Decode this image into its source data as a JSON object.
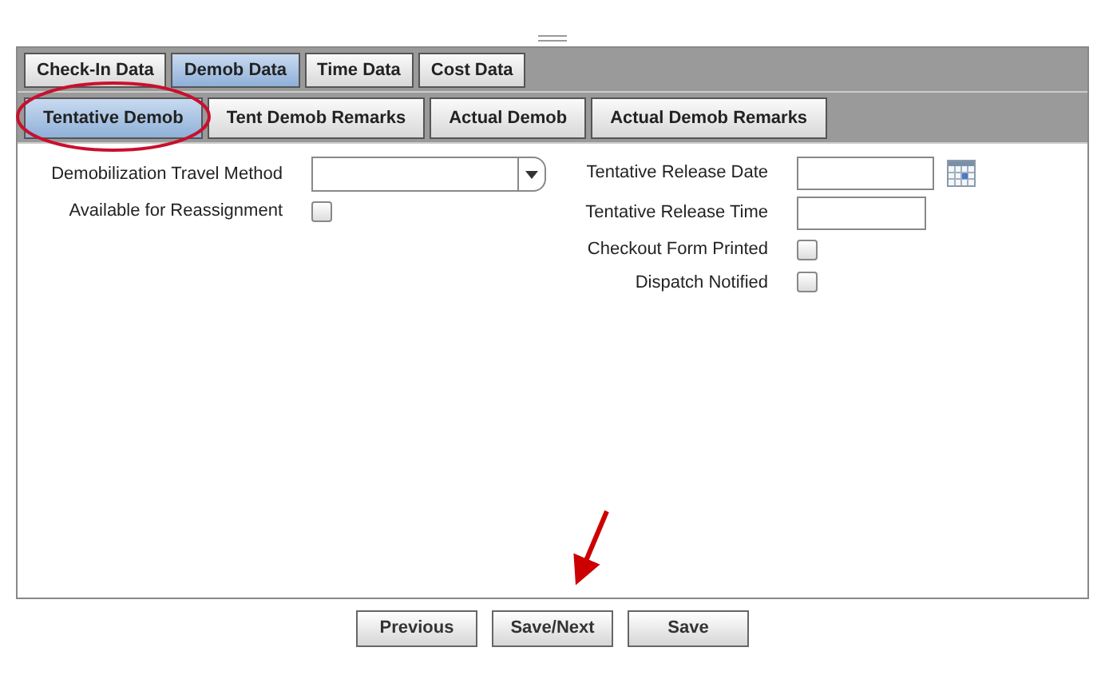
{
  "primary_tabs": [
    {
      "label": "Check-In Data",
      "selected": false
    },
    {
      "label": "Demob Data",
      "selected": true
    },
    {
      "label": "Time Data",
      "selected": false
    },
    {
      "label": "Cost Data",
      "selected": false
    }
  ],
  "secondary_tabs": [
    {
      "label": "Tentative Demob",
      "selected": true
    },
    {
      "label": "Tent Demob Remarks",
      "selected": false
    },
    {
      "label": "Actual Demob",
      "selected": false
    },
    {
      "label": "Actual Demob Remarks",
      "selected": false
    }
  ],
  "left_fields": [
    {
      "kind": "select",
      "label": "Demobilization Travel Method"
    },
    {
      "kind": "checkbox",
      "label": "Available for Reassignment",
      "checked": false
    }
  ],
  "right_fields": [
    {
      "kind": "date",
      "label": "Tentative Release Date"
    },
    {
      "kind": "text",
      "label": "Tentative Release Time"
    },
    {
      "kind": "checkbox",
      "label": "Checkout Form Printed",
      "checked": false
    },
    {
      "kind": "checkbox",
      "label": "Dispatch Notified",
      "checked": false
    }
  ],
  "buttons": [
    "Previous",
    "Save/Next",
    "Save"
  ]
}
